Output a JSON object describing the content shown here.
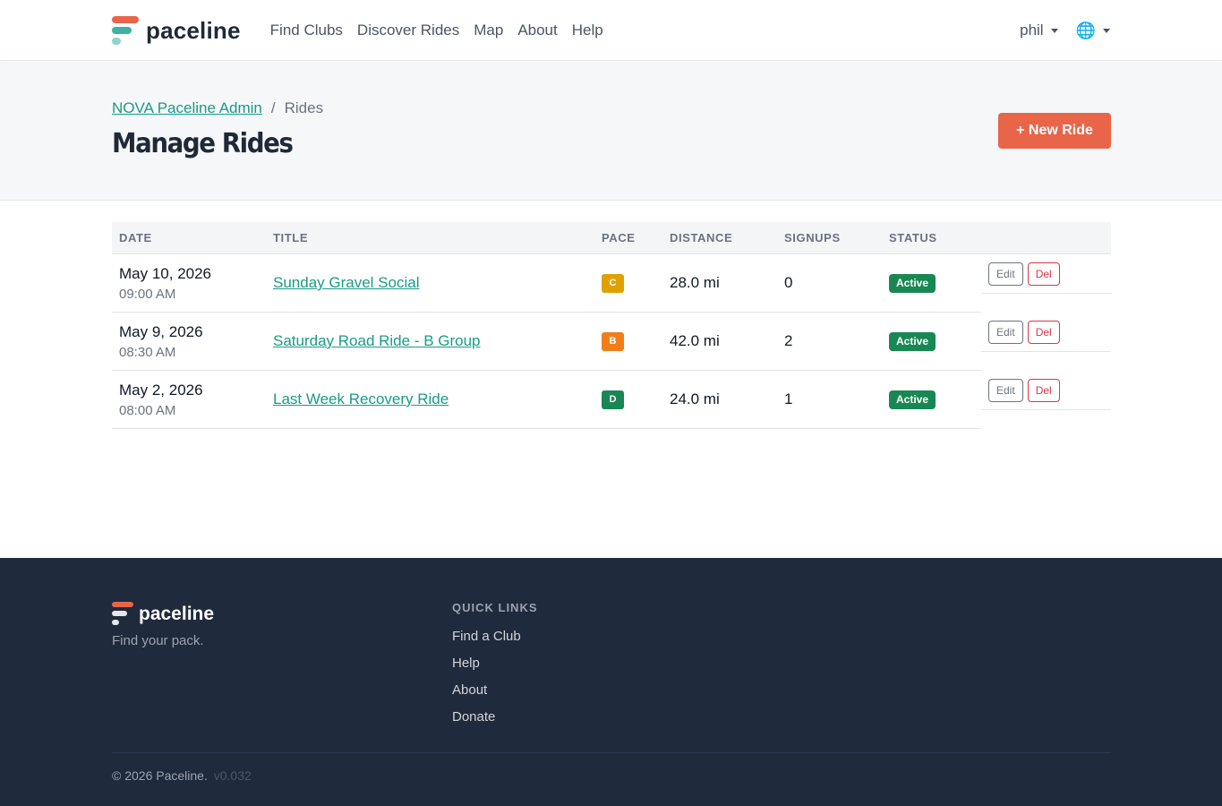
{
  "brand": {
    "name": "paceline"
  },
  "nav": {
    "links": [
      "Find Clubs",
      "Discover Rides",
      "Map",
      "About",
      "Help"
    ],
    "user": "phil"
  },
  "header": {
    "breadcrumb_parent": "NOVA Paceline Admin",
    "breadcrumb_separator": "/",
    "breadcrumb_current": "Rides",
    "title": "Manage Rides",
    "new_ride_label": "+ New Ride"
  },
  "table": {
    "columns": [
      "DATE",
      "TITLE",
      "PACE",
      "DISTANCE",
      "SIGNUPS",
      "STATUS"
    ],
    "edit_label": "Edit",
    "delete_label": "Del",
    "rows": [
      {
        "date": "May 10, 2026",
        "time": "09:00 AM",
        "title": "Sunday Gravel Social",
        "pace": "C",
        "pace_color": "#e0a100",
        "distance": "28.0 mi",
        "signups": "0",
        "status": "Active"
      },
      {
        "date": "May 9, 2026",
        "time": "08:30 AM",
        "title": "Saturday Road Ride - B Group",
        "pace": "B",
        "pace_color": "#f07f1a",
        "distance": "42.0 mi",
        "signups": "2",
        "status": "Active"
      },
      {
        "date": "May 2, 2026",
        "time": "08:00 AM",
        "title": "Last Week Recovery Ride",
        "pace": "D",
        "pace_color": "#198754",
        "distance": "24.0 mi",
        "signups": "1",
        "status": "Active"
      }
    ]
  },
  "footer": {
    "brand": "paceline",
    "tagline": "Find your pack.",
    "links_title": "QUICK LINKS",
    "links": [
      "Find a Club",
      "Help",
      "About",
      "Donate"
    ],
    "copyright": "© 2026 Paceline.",
    "version": "v0.032"
  },
  "colors": {
    "accent": "#e8654a",
    "link": "#1a9b86",
    "footer_bg": "#1f2a3d",
    "active": "#198754"
  }
}
